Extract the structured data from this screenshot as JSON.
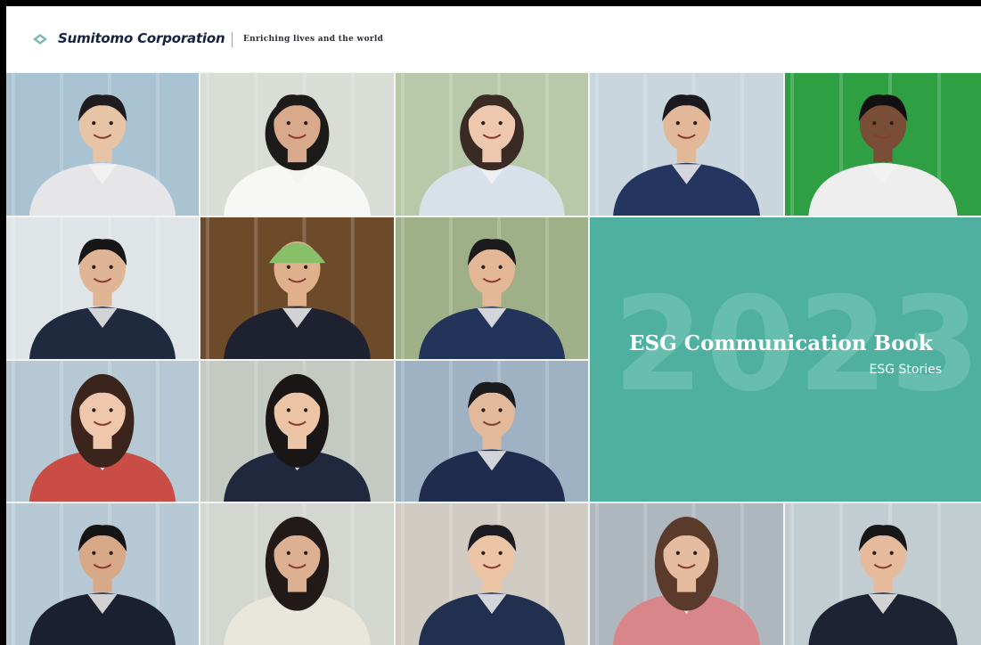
{
  "header": {
    "brand": "Sumitomo Corporation",
    "tagline": "Enriching lives and the world"
  },
  "cover": {
    "year": "2023",
    "title": "ESG Communication Book",
    "subtitle": "ESG Stories"
  },
  "portraits": [
    {
      "bg": "#a9c3d3",
      "shirt": "#e6e6e8",
      "hair": "#1e1c1f",
      "skin": "#e8c4a7",
      "style": "short"
    },
    {
      "bg": "#d9ddd6",
      "shirt": "#f7f7f5",
      "hair": "#1d1a1a",
      "skin": "#d8a98a",
      "style": "ponytail"
    },
    {
      "bg": "#b7c9a9",
      "shirt": "#d8e0ea",
      "hair": "#3a2a24",
      "skin": "#eec8ae",
      "style": "bob"
    },
    {
      "bg": "#c9d6dd",
      "shirt": "#243660",
      "hair": "#1a1a1e",
      "skin": "#e2b898",
      "style": "short"
    },
    {
      "bg": "#2ea043",
      "shirt": "#eeeeee",
      "hair": "#111111",
      "skin": "#7a4d36",
      "style": "short"
    },
    {
      "bg": "#dfe4e6",
      "shirt": "#1f2a3f",
      "hair": "#161616",
      "skin": "#e0b596",
      "style": "short"
    },
    {
      "bg": "#6d4a2a",
      "shirt": "#1d2130",
      "hair": "#88c06a",
      "skin": "#e0b08c",
      "style": "helmet"
    },
    {
      "bg": "#9fb089",
      "shirt": "#23345a",
      "hair": "#1b1a1d",
      "skin": "#e4b897",
      "style": "short"
    },
    {
      "bg": "#b5c8d4",
      "shirt": "#c94c45",
      "hair": "#3a241c",
      "skin": "#efc7ad",
      "style": "long"
    },
    {
      "bg": "#c4c9c2",
      "shirt": "#20283e",
      "hair": "#1b1616",
      "skin": "#ecc4a6",
      "style": "long"
    },
    {
      "bg": "#9fb2c4",
      "shirt": "#1f2c4e",
      "hair": "#1b1a1d",
      "skin": "#e2b99a",
      "style": "short"
    },
    {
      "bg": "#b6c9d4",
      "shirt": "#1b2030",
      "hair": "#141414",
      "skin": "#d8a986",
      "style": "short"
    },
    {
      "bg": "#d4d6d0",
      "shirt": "#e9e6dc",
      "hair": "#221a18",
      "skin": "#dcb090",
      "style": "long"
    },
    {
      "bg": "#d0ccc4",
      "shirt": "#22304f",
      "hair": "#1c1b1f",
      "skin": "#ecc5a6",
      "style": "short"
    },
    {
      "bg": "#aeb7bd",
      "shirt": "#d9868a",
      "hair": "#5a3a2a",
      "skin": "#e6bca0",
      "style": "long"
    },
    {
      "bg": "#c2cdd2",
      "shirt": "#1d2333",
      "hair": "#171717",
      "skin": "#e6bb9b",
      "style": "short"
    }
  ]
}
